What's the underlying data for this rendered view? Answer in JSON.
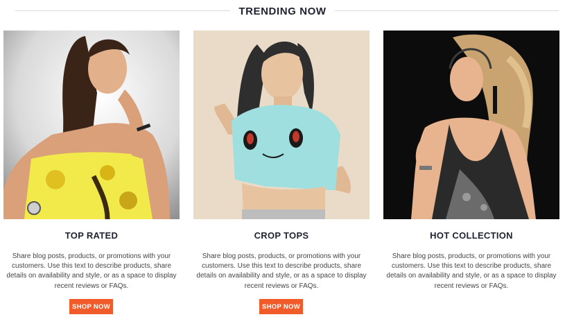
{
  "section": {
    "title": "TRENDING NOW"
  },
  "cards": [
    {
      "title": "TOP RATED",
      "description": "Share blog posts, products, or promotions with your customers. Use this text to describe products, share details on availability and style, or as a space to display recent reviews or FAQs.",
      "button": "SHOP NOW"
    },
    {
      "title": "CROP TOPS",
      "description": "Share blog posts, products, or promotions with your customers. Use this text to describe products, share details on availability and style, or as a space to display recent reviews or FAQs.",
      "button": "SHOP NOW"
    },
    {
      "title": "HOT COLLECTION",
      "description": "Share blog posts, products, or promotions with your customers. Use this text to describe products, share details on availability and style, or as a space to display recent reviews or FAQs."
    }
  ],
  "colors": {
    "accent": "#f15a29",
    "heading": "#1f2230",
    "divider": "#d9d9d9"
  }
}
